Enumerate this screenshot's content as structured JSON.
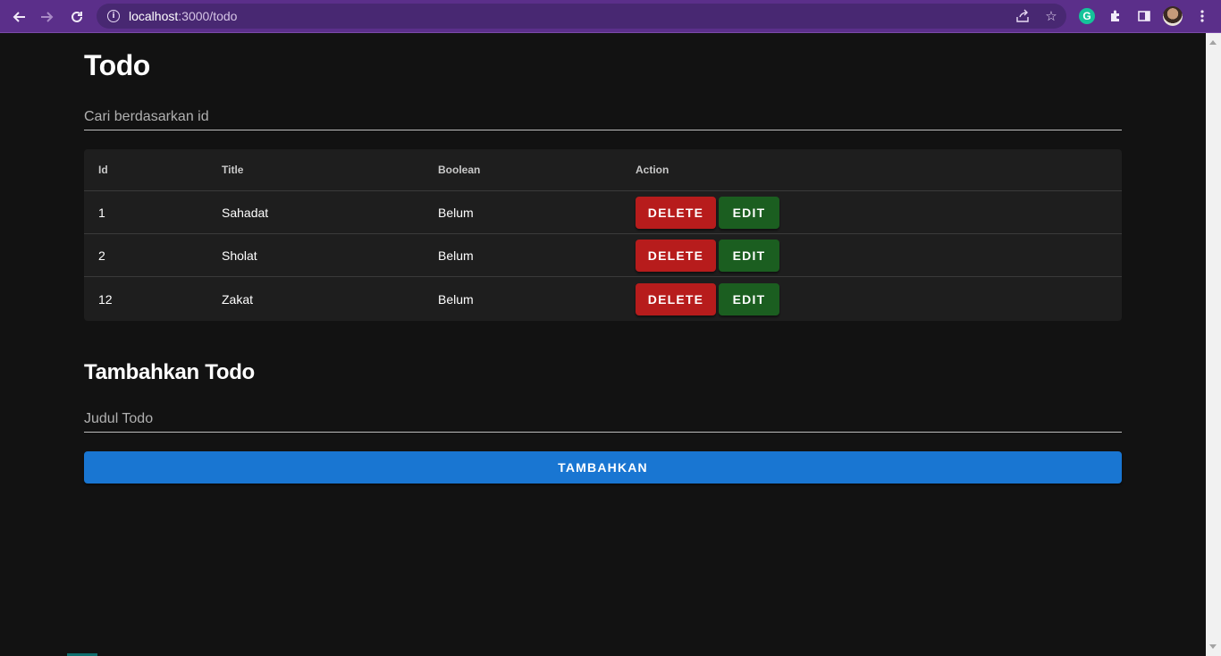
{
  "browser": {
    "url_host": "localhost",
    "url_path": ":3000/todo",
    "icons": {
      "back": "arrow-left-icon",
      "forward": "arrow-right-icon",
      "reload": "reload-icon",
      "info": "info-icon",
      "share": "share-icon",
      "bookmark": "star-icon",
      "grammarly": "grammarly-icon",
      "extensions": "puzzle-icon",
      "side_panel": "side-panel-icon",
      "menu": "kebab-menu-icon"
    },
    "grammarly_letter": "G"
  },
  "page": {
    "title": "Todo",
    "search_placeholder": "Cari berdasarkan id"
  },
  "table": {
    "headers": [
      "Id",
      "Title",
      "Boolean",
      "Action"
    ],
    "rows": [
      {
        "id": "1",
        "title": "Sahadat",
        "boolean": "Belum"
      },
      {
        "id": "2",
        "title": "Sholat",
        "boolean": "Belum"
      },
      {
        "id": "12",
        "title": "Zakat",
        "boolean": "Belum"
      }
    ],
    "delete_label": "DELETE",
    "edit_label": "EDIT"
  },
  "add_section": {
    "title": "Tambahkan Todo",
    "input_placeholder": "Judul Todo",
    "button_label": "TAMBAHKAN"
  },
  "colors": {
    "background": "#121212",
    "table_bg": "#1e1e1e",
    "delete": "#b71c1c",
    "edit": "#1b5e20",
    "primary": "#1976d2",
    "chrome": "#5b2f8a"
  }
}
